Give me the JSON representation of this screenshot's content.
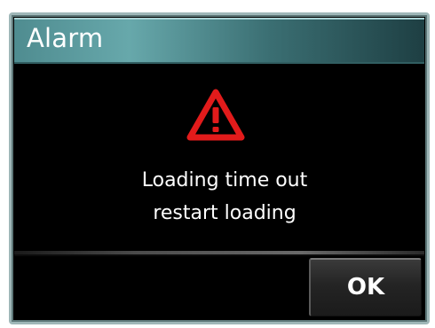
{
  "dialog": {
    "title": "Alarm",
    "icon": "warning-triangle-icon",
    "message_lines": [
      "Loading time out",
      "restart loading"
    ],
    "ok_label": "OK"
  },
  "colors": {
    "warning_red": "#e21b1b",
    "title_accent": "#67a8ab",
    "background": "#000000",
    "text": "#ffffff"
  }
}
